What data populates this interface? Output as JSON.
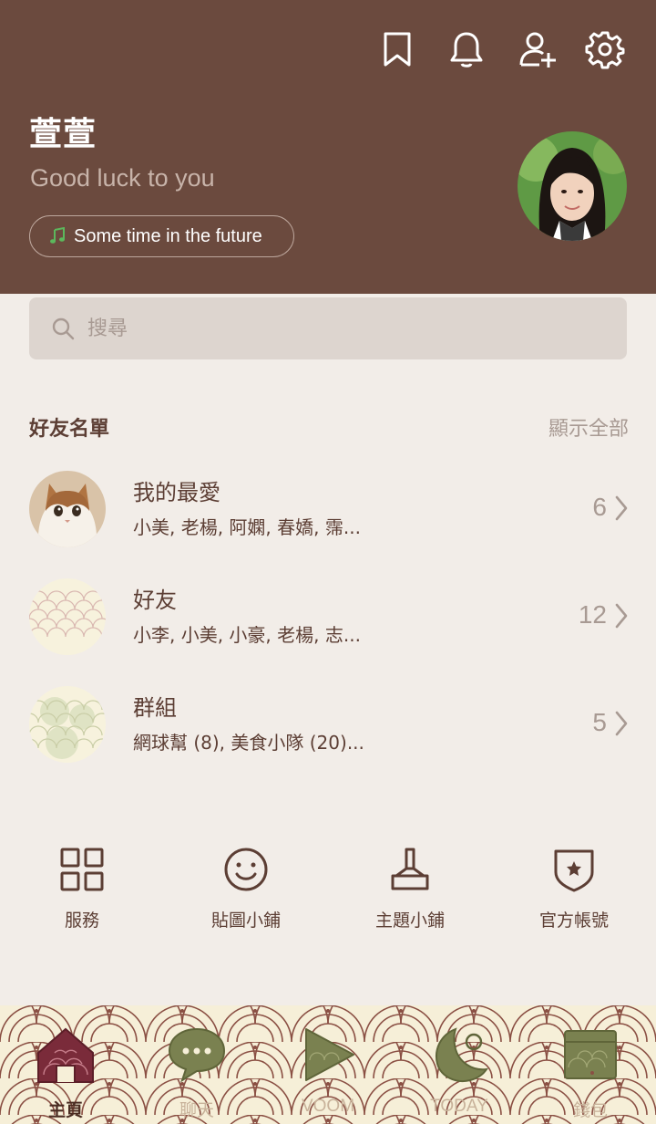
{
  "header": {
    "profile_name": "萱萱",
    "status_message": "Good luck to you",
    "music_title": "Some time in the future"
  },
  "search": {
    "placeholder": "搜尋"
  },
  "friends": {
    "title": "好友名單",
    "show_all": "顯示全部",
    "rows": [
      {
        "title": "我的最愛",
        "subtitle": "小美, 老楊, 阿嫻, 春嬌, 霈...",
        "count": "6"
      },
      {
        "title": "好友",
        "subtitle": "小李, 小美, 小豪, 老楊, 志...",
        "count": "12"
      },
      {
        "title": "群組",
        "subtitle": "網球幫 (8), 美食小隊 (20)...",
        "count": "5"
      }
    ]
  },
  "services": [
    {
      "label": "服務",
      "icon": "grid-icon"
    },
    {
      "label": "貼圖小鋪",
      "icon": "smiley-icon"
    },
    {
      "label": "主題小鋪",
      "icon": "brush-icon"
    },
    {
      "label": "官方帳號",
      "icon": "shield-star-icon"
    }
  ],
  "tabs": [
    {
      "label": "主頁",
      "icon": "home-icon",
      "active": true
    },
    {
      "label": "聊天",
      "icon": "chat-bubble-icon"
    },
    {
      "label": "VOOM",
      "icon": "play-icon"
    },
    {
      "label": "TODAY",
      "icon": "moon-icon"
    },
    {
      "label": "錢包",
      "icon": "wallet-icon"
    }
  ],
  "colors": {
    "header_bg": "#6b4a3e",
    "page_bg": "#f2ede8",
    "text_brown": "#5c3e34",
    "muted": "#a89a93",
    "tab_icon_green": "#7a8150",
    "tab_home_active": "#7a2b3a",
    "music_icon_green": "#5cb85c"
  }
}
